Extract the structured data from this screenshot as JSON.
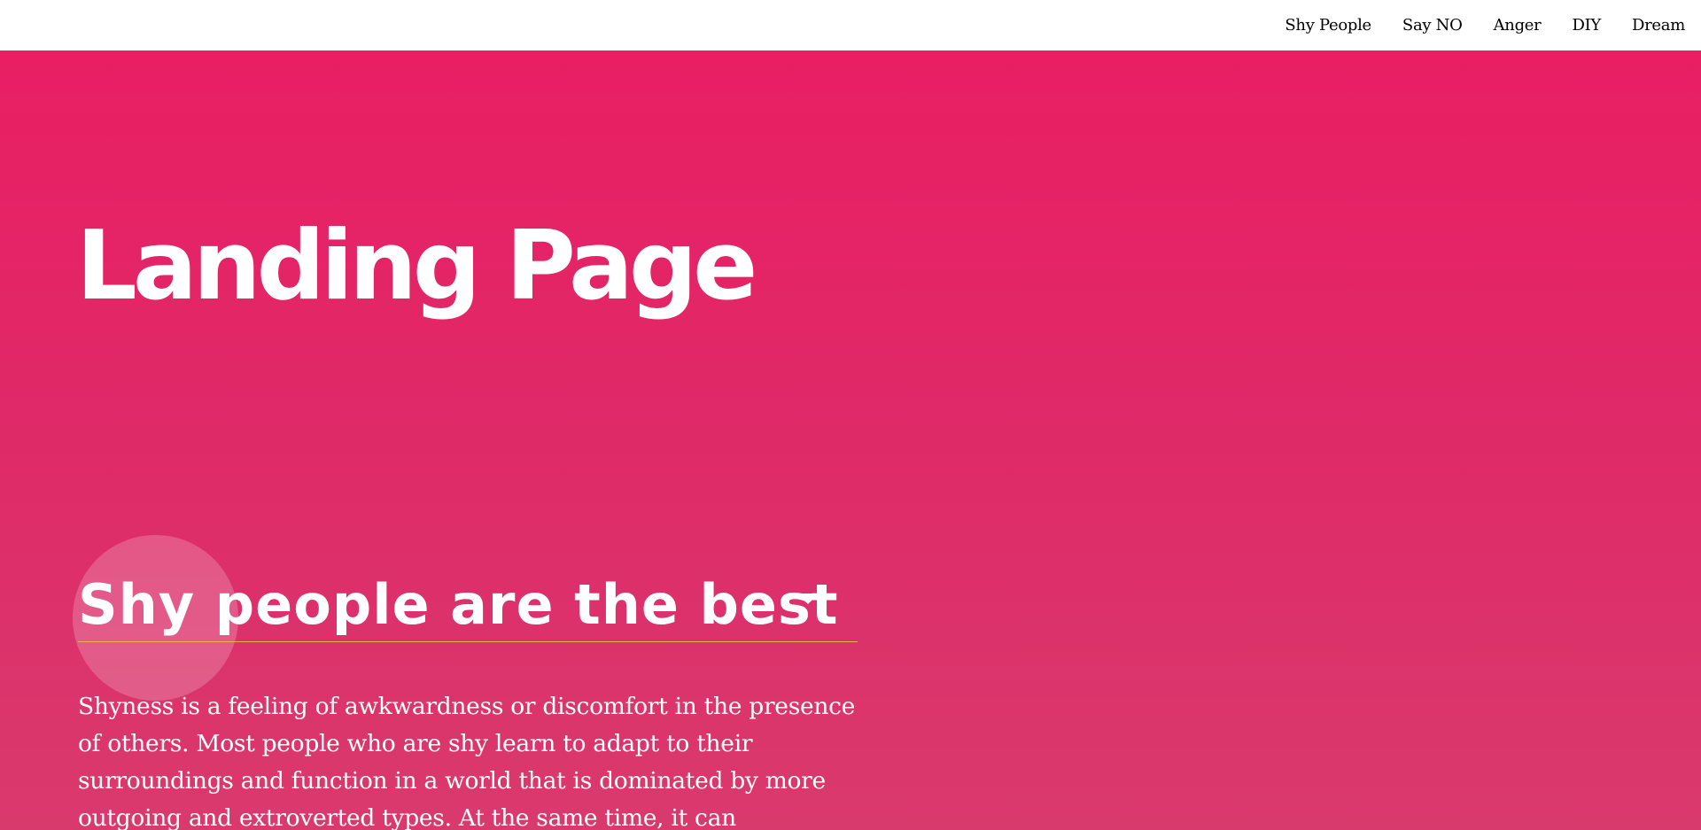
{
  "nav": {
    "items": [
      {
        "label": "Shy People"
      },
      {
        "label": "Say NO"
      },
      {
        "label": "Anger"
      },
      {
        "label": "DIY"
      },
      {
        "label": "Dream"
      }
    ]
  },
  "hero": {
    "title": "Landing Page",
    "select": {
      "selected": "Shy people are the best",
      "caret_icon": "caret-down-icon"
    },
    "paragraph": "Shyness is a feeling of awkwardness or discomfort in the presence of others. Most people who are shy learn to adapt to their surroundings and function in a world that is dominated by more outgoing and extroverted types. At the same time, it can"
  },
  "colors": {
    "hero_top": "#e91e63",
    "hero_bottom": "#d93a6e",
    "select_underline": "#f3b44a",
    "text_light": "#ffffff",
    "nav_text": "#000000"
  }
}
